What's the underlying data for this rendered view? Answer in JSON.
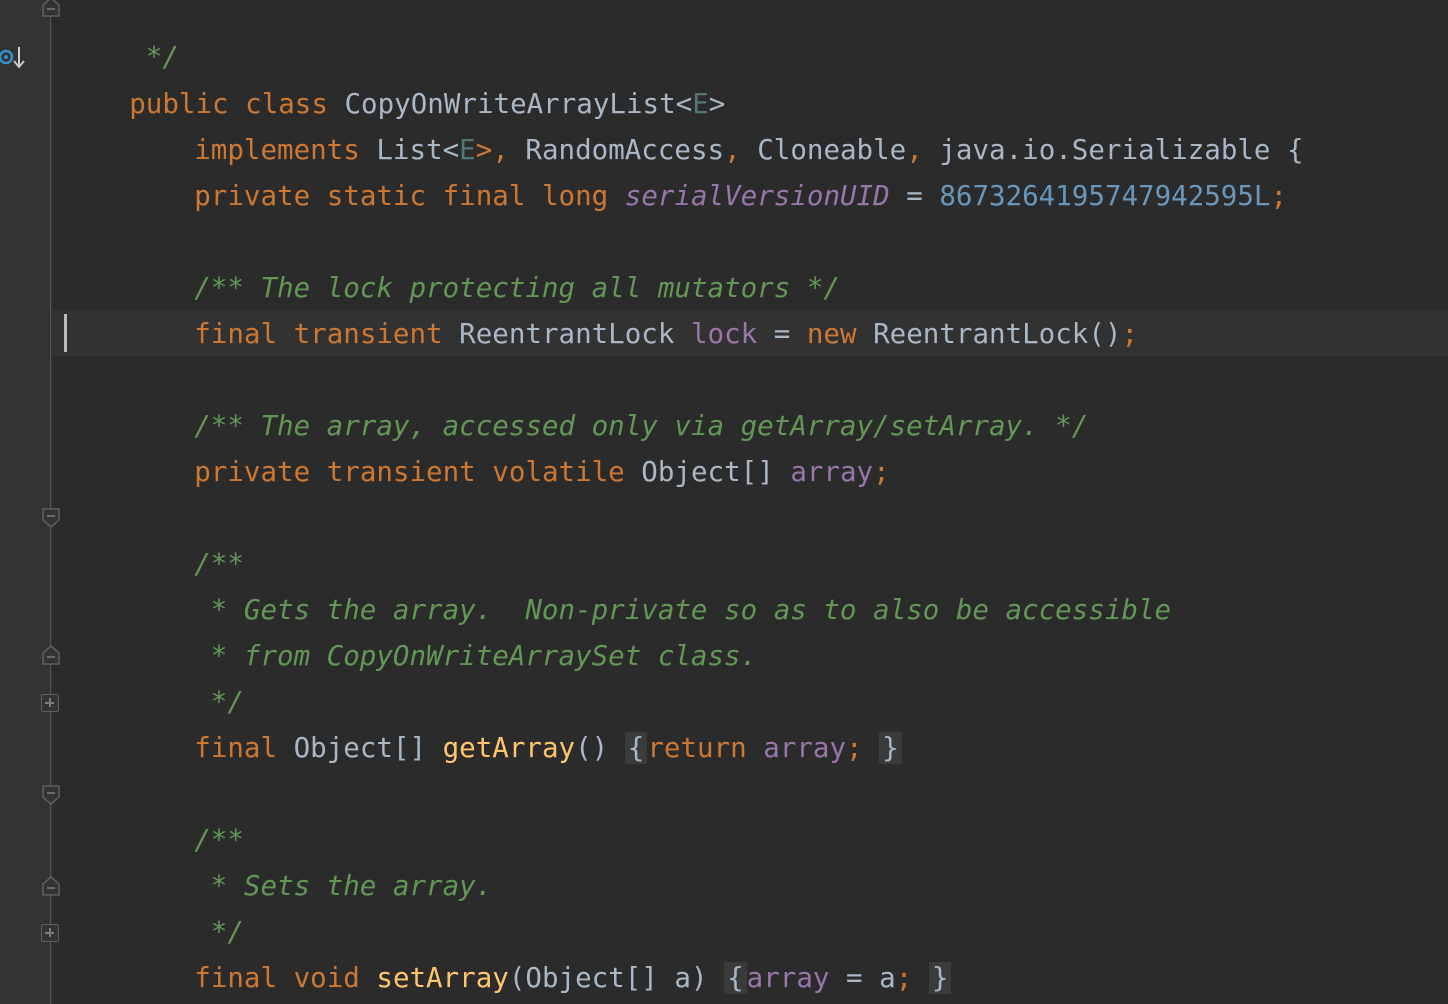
{
  "editor": {
    "lines": {
      "l0": {
        "comment_end": " */"
      },
      "l1": {
        "kw_public": "public",
        "kw_class": "class",
        "class_name": "CopyOnWriteArrayList",
        "lt": "<",
        "type_param": "E",
        "gt": ">"
      },
      "l2": {
        "kw_implements": "implements",
        "list": "List",
        "lt": "<",
        "type_param": "E",
        "gt_comma": ">, ",
        "random_access": "RandomAccess",
        "comma1": ", ",
        "cloneable": "Cloneable",
        "comma2": ", ",
        "serializable": "java.io.Serializable",
        "brace": " {"
      },
      "l3": {
        "kw_private": "private",
        "kw_static": "static",
        "kw_final": "final",
        "kw_long": "long",
        "field": "serialVersionUID",
        "eq": " = ",
        "number": "8673264195747942595L",
        "semi": ";"
      },
      "l5": {
        "comment": "/** The lock protecting all mutators */"
      },
      "l6": {
        "kw_final": "final",
        "kw_transient": "transient",
        "type": "ReentrantLock",
        "field": "lock",
        "eq": " = ",
        "kw_new": "new",
        "ctor": "ReentrantLock()",
        "semi": ";"
      },
      "l8": {
        "comment": "/** The array, accessed only via getArray/setArray. */"
      },
      "l9": {
        "kw_private": "private",
        "kw_transient": "transient",
        "kw_volatile": "volatile",
        "type": "Object[]",
        "field": "array",
        "semi": ";"
      },
      "l11": {
        "comment": "/**"
      },
      "l12": {
        "comment": " * Gets the array.  Non-private so as to also be accessible"
      },
      "l13": {
        "comment": " * from CopyOnWriteArraySet class."
      },
      "l14": {
        "comment": " */"
      },
      "l15": {
        "kw_final": "final",
        "type": "Object[]",
        "method": "getArray",
        "parens": "()",
        "open_brace": "{",
        "kw_return": "return",
        "field": "array",
        "semi": ";",
        "close_brace": "}"
      },
      "l17": {
        "comment": "/**"
      },
      "l18": {
        "comment": " * Sets the array."
      },
      "l19": {
        "comment": " */"
      },
      "l20": {
        "kw_final": "final",
        "kw_void": "void",
        "method": "setArray",
        "open_paren": "(",
        "type": "Object[]",
        "param": "a",
        "close_paren": ")",
        "open_brace": "{",
        "field": "array",
        "eq": " = ",
        "param2": "a",
        "semi": ";",
        "close_brace": "}"
      }
    }
  },
  "gutter_icons": [
    "override-icon",
    "fold-end-icon",
    "fold-start-icon",
    "fold-end-icon",
    "expand-icon",
    "fold-start-icon",
    "fold-end-icon",
    "expand-icon"
  ],
  "colors": {
    "background": "#2b2b2b",
    "gutter": "#313335",
    "keyword": "#cc7832",
    "text": "#a9b7c6",
    "field": "#9876aa",
    "number": "#6897bb",
    "comment": "#629755",
    "method": "#ffc66d",
    "type_param": "#507874"
  }
}
